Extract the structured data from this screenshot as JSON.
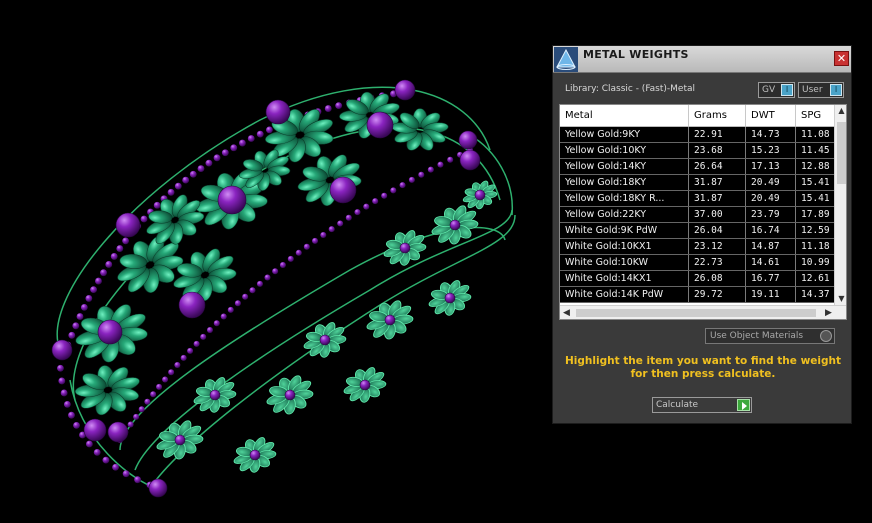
{
  "panel": {
    "title": "METAL WEIGHTS",
    "close_label": "✕",
    "library_label": "Library: Classic - (Fast)-Metal",
    "gv_label": "GV",
    "user_label": "User",
    "toggle_indicator": "I",
    "use_object_label": "Use Object Materials",
    "instructions": "Highlight the item you want to find the weight for then press calculate.",
    "calculate_label": "Calculate"
  },
  "table": {
    "columns": [
      "Metal",
      "Grams",
      "DWT",
      "SPG"
    ],
    "rows": [
      [
        "Yellow Gold:9KY",
        "22.91",
        "14.73",
        "11.08"
      ],
      [
        "Yellow Gold:10KY",
        "23.68",
        "15.23",
        "11.45"
      ],
      [
        "Yellow Gold:14KY",
        "26.64",
        "17.13",
        "12.88"
      ],
      [
        "Yellow Gold:18KY",
        "31.87",
        "20.49",
        "15.41"
      ],
      [
        "Yellow Gold:18KY R...",
        "31.87",
        "20.49",
        "15.41"
      ],
      [
        "Yellow Gold:22KY",
        "37.00",
        "23.79",
        "17.89"
      ],
      [
        "White Gold:9K PdW",
        "26.04",
        "16.74",
        "12.59"
      ],
      [
        "White Gold:10KX1",
        "23.12",
        "14.87",
        "11.18"
      ],
      [
        "White Gold:10KW",
        "22.73",
        "14.61",
        "10.99"
      ],
      [
        "White Gold:14KX1",
        "26.08",
        "16.77",
        "12.61"
      ],
      [
        "White Gold:14K PdW",
        "29.72",
        "19.11",
        "14.37"
      ]
    ]
  },
  "colors": {
    "petal": "#1f8a62",
    "petal_highlight": "#3fd49a",
    "gem": "#7a1fa8",
    "frame": "#33c47a",
    "accent_text": "#f0c020"
  }
}
